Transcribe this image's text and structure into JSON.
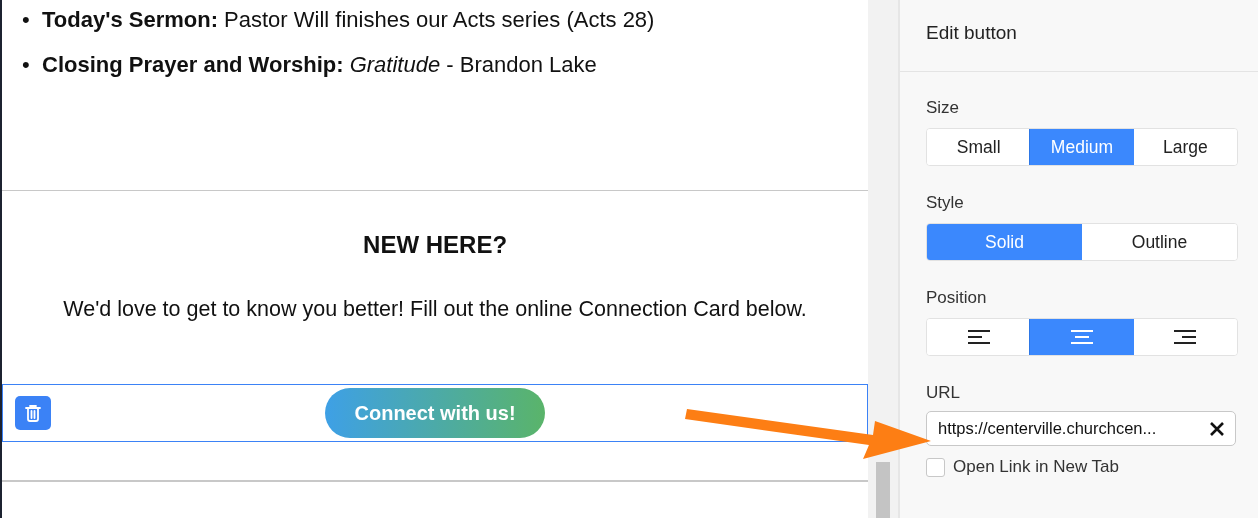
{
  "content": {
    "bullets": [
      {
        "marker": "•",
        "text": "**Today's Sermon:** Pastor Will finishes our Acts series (Acts 28)"
      },
      {
        "marker": "•",
        "text": "**Closing Prayer and Worship:** *Gratitude* - Brandon Lake"
      }
    ],
    "heading": "NEW HERE?",
    "paragraph": "We'd love to get to know you better! Fill out the online Connection Card below.",
    "button_block": {
      "selected": true,
      "label": "Connect with us!"
    }
  },
  "panel": {
    "title": "Edit button",
    "size": {
      "label": "Size",
      "options": [
        {
          "label": "Small",
          "selected": false
        },
        {
          "label": "Medium",
          "selected": true
        },
        {
          "label": "Large",
          "selected": false
        }
      ]
    },
    "style": {
      "label": "Style",
      "options": [
        {
          "label": "Solid",
          "selected": true
        },
        {
          "label": "Outline",
          "selected": false
        }
      ]
    },
    "position": {
      "label": "Position",
      "options": [
        {
          "kind": "left",
          "selected": false
        },
        {
          "kind": "center",
          "selected": true
        },
        {
          "kind": "right",
          "selected": false
        }
      ]
    },
    "url": {
      "label": "URL",
      "value": "https://centerville.churchcen..."
    },
    "new_tab": {
      "label": "Open Link in New Tab",
      "checked": false
    }
  }
}
